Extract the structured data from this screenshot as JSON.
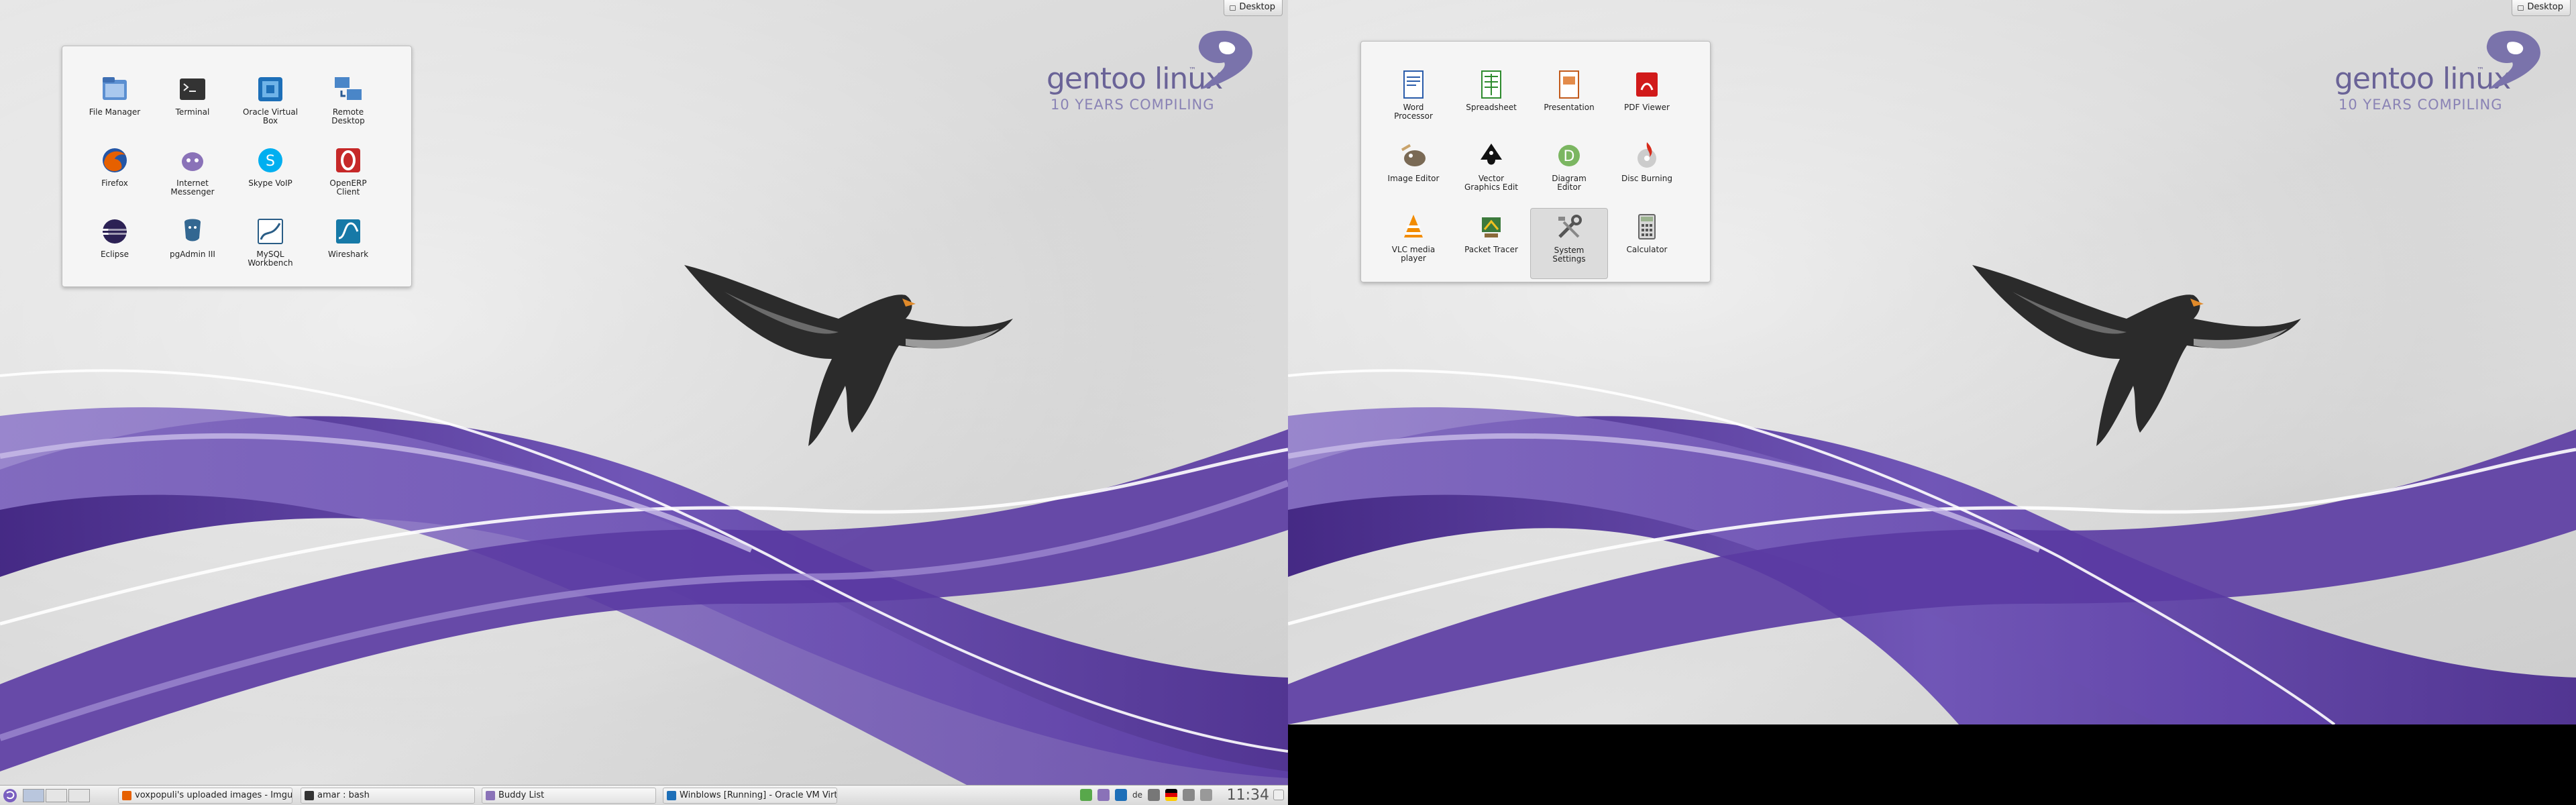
{
  "desktop_button_label": "Desktop",
  "branding": {
    "title": "gentoo linux",
    "trademark": "™",
    "subtitle": "10 YEARS COMPILING"
  },
  "left_folder": {
    "apps": [
      {
        "label": "File Manager",
        "icon": "file-manager-icon"
      },
      {
        "label": "Terminal",
        "icon": "terminal-icon"
      },
      {
        "label": "Oracle Virtual\nBox",
        "icon": "virtualbox-icon"
      },
      {
        "label": "Remote\nDesktop",
        "icon": "remote-desktop-icon"
      },
      {
        "label": "Firefox",
        "icon": "firefox-icon"
      },
      {
        "label": "Internet\nMessenger",
        "icon": "messenger-icon"
      },
      {
        "label": "Skype VoIP",
        "icon": "skype-icon"
      },
      {
        "label": "OpenERP\nClient",
        "icon": "openerp-icon"
      },
      {
        "label": "Eclipse",
        "icon": "eclipse-icon"
      },
      {
        "label": "pgAdmin III",
        "icon": "pgadmin-icon"
      },
      {
        "label": "MySQL\nWorkbench",
        "icon": "mysql-workbench-icon"
      },
      {
        "label": "Wireshark",
        "icon": "wireshark-icon"
      }
    ]
  },
  "right_folder": {
    "apps": [
      {
        "label": "Word\nProcessor",
        "icon": "word-processor-icon"
      },
      {
        "label": "Spreadsheet",
        "icon": "spreadsheet-icon"
      },
      {
        "label": "Presentation",
        "icon": "presentation-icon"
      },
      {
        "label": "PDF Viewer",
        "icon": "pdf-viewer-icon"
      },
      {
        "label": "Image Editor",
        "icon": "image-editor-icon"
      },
      {
        "label": "Vector\nGraphics Edit",
        "icon": "vector-graphics-icon"
      },
      {
        "label": "Diagram\nEditor",
        "icon": "diagram-editor-icon"
      },
      {
        "label": "Disc Burning",
        "icon": "disc-burning-icon"
      },
      {
        "label": "VLC media\nplayer",
        "icon": "vlc-icon"
      },
      {
        "label": "Packet Tracer",
        "icon": "packet-tracer-icon"
      },
      {
        "label": "System\nSettings",
        "icon": "system-settings-icon"
      },
      {
        "label": "Calculator",
        "icon": "calculator-icon"
      }
    ]
  },
  "taskbar": {
    "tasks": [
      {
        "label": "voxpopuli's uploaded images - Imgur",
        "icon": "firefox-task-icon"
      },
      {
        "label": "amar : bash",
        "icon": "terminal-task-icon"
      },
      {
        "label": "Buddy List",
        "icon": "messenger-task-icon"
      },
      {
        "label": "Winblows [Running] - Oracle VM Virt...",
        "icon": "virtualbox-task-icon"
      }
    ],
    "clock": "11:34",
    "tray_keyboard_layout": "de"
  },
  "colors": {
    "purple_dark": "#4b2d8f",
    "purple_mid": "#6e52b3",
    "purple_light": "#9b86d1",
    "taskbar_bg": "#e6e6e6"
  }
}
